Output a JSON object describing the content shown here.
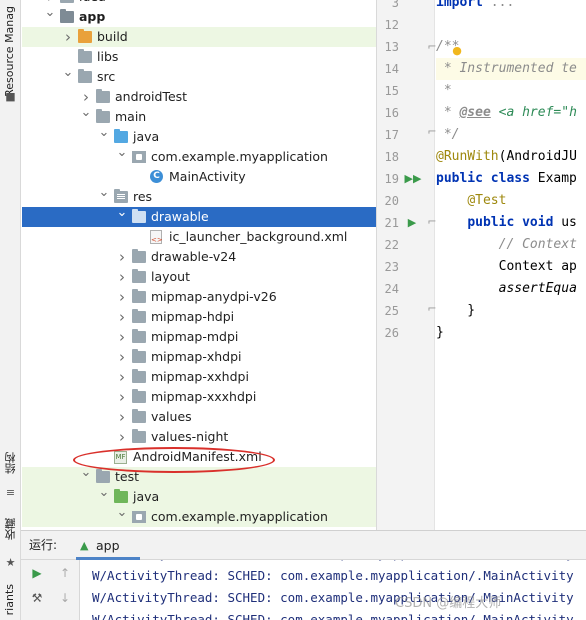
{
  "tool_strip": {
    "resource_manager": "Resource Manag",
    "structure": "结构",
    "favorites": "收藏",
    "variants": "riants"
  },
  "tree": {
    "rows": [
      {
        "label": "idea",
        "depth": 2,
        "arrow": "right",
        "icon": "folder-grey"
      },
      {
        "label": "app",
        "depth": 2,
        "arrow": "down",
        "icon": "module",
        "bold": true
      },
      {
        "label": "build",
        "depth": 3,
        "arrow": "right",
        "icon": "folder-orange",
        "green": true
      },
      {
        "label": "libs",
        "depth": 3,
        "arrow": "",
        "icon": "folder-grey"
      },
      {
        "label": "src",
        "depth": 3,
        "arrow": "down",
        "icon": "folder-grey"
      },
      {
        "label": "androidTest",
        "depth": 4,
        "arrow": "right",
        "icon": "folder-grey"
      },
      {
        "label": "main",
        "depth": 4,
        "arrow": "down",
        "icon": "folder-grey"
      },
      {
        "label": "java",
        "depth": 5,
        "arrow": "down",
        "icon": "folder-blue"
      },
      {
        "label": "com.example.myapplication",
        "depth": 6,
        "arrow": "down",
        "icon": "package"
      },
      {
        "label": "MainActivity",
        "depth": 7,
        "arrow": "",
        "icon": "class"
      },
      {
        "label": "res",
        "depth": 5,
        "arrow": "down",
        "icon": "folder-res"
      },
      {
        "label": "drawable",
        "depth": 6,
        "arrow": "down",
        "icon": "folder-white",
        "selected": true
      },
      {
        "label": "ic_launcher_background.xml",
        "depth": 7,
        "arrow": "",
        "icon": "xml"
      },
      {
        "label": "drawable-v24",
        "depth": 6,
        "arrow": "right",
        "icon": "folder-grey"
      },
      {
        "label": "layout",
        "depth": 6,
        "arrow": "right",
        "icon": "folder-grey"
      },
      {
        "label": "mipmap-anydpi-v26",
        "depth": 6,
        "arrow": "right",
        "icon": "folder-grey"
      },
      {
        "label": "mipmap-hdpi",
        "depth": 6,
        "arrow": "right",
        "icon": "folder-grey"
      },
      {
        "label": "mipmap-mdpi",
        "depth": 6,
        "arrow": "right",
        "icon": "folder-grey"
      },
      {
        "label": "mipmap-xhdpi",
        "depth": 6,
        "arrow": "right",
        "icon": "folder-grey"
      },
      {
        "label": "mipmap-xxhdpi",
        "depth": 6,
        "arrow": "right",
        "icon": "folder-grey"
      },
      {
        "label": "mipmap-xxxhdpi",
        "depth": 6,
        "arrow": "right",
        "icon": "folder-grey"
      },
      {
        "label": "values",
        "depth": 6,
        "arrow": "right",
        "icon": "folder-grey"
      },
      {
        "label": "values-night",
        "depth": 6,
        "arrow": "right",
        "icon": "folder-grey"
      },
      {
        "label": "AndroidManifest.xml",
        "depth": 5,
        "arrow": "",
        "icon": "manifest"
      },
      {
        "label": "test",
        "depth": 4,
        "arrow": "down",
        "icon": "folder-grey",
        "green": true
      },
      {
        "label": "java",
        "depth": 5,
        "arrow": "down",
        "icon": "folder-green",
        "green": true
      },
      {
        "label": "com.example.myapplication",
        "depth": 6,
        "arrow": "down",
        "icon": "package",
        "green": true
      }
    ]
  },
  "editor": {
    "line_numbers": [
      "3",
      "12",
      "13",
      "14",
      "15",
      "16",
      "17",
      "18",
      "19",
      "20",
      "21",
      "22",
      "23",
      "24",
      "25",
      "26"
    ],
    "lines": [
      [
        {
          "t": "import ",
          "c": "kw"
        },
        {
          "t": "...",
          "c": "grey"
        }
      ],
      [],
      [
        {
          "t": "/**",
          "c": "doc"
        }
      ],
      [
        {
          "t": " * Instrumented te",
          "c": "doc"
        }
      ],
      [
        {
          "t": " *",
          "c": "doc"
        }
      ],
      [
        {
          "t": " * ",
          "c": "doc"
        },
        {
          "t": "@see",
          "c": "doctag"
        },
        {
          "t": " ",
          "c": "doc"
        },
        {
          "t": "<a href=\"h",
          "c": "link"
        }
      ],
      [
        {
          "t": " */",
          "c": "doc"
        }
      ],
      [
        {
          "t": "@RunWith",
          "c": "ann"
        },
        {
          "t": "(AndroidJU",
          "c": ""
        }
      ],
      [
        {
          "t": "public class ",
          "c": "kw"
        },
        {
          "t": "Examp",
          "c": ""
        }
      ],
      [
        {
          "t": "    ",
          "c": ""
        },
        {
          "t": "@Test",
          "c": "ann"
        }
      ],
      [
        {
          "t": "    ",
          "c": ""
        },
        {
          "t": "public void ",
          "c": "kw"
        },
        {
          "t": "us",
          "c": ""
        }
      ],
      [
        {
          "t": "        ",
          "c": ""
        },
        {
          "t": "// Context",
          "c": "grey-i"
        }
      ],
      [
        {
          "t": "        Context ap",
          "c": ""
        }
      ],
      [
        {
          "t": "        ",
          "c": ""
        },
        {
          "t": "assertEqua",
          "c": "plain-i"
        }
      ],
      [
        {
          "t": "    }",
          "c": ""
        }
      ],
      [
        {
          "t": "}",
          "c": ""
        }
      ]
    ]
  },
  "run_panel": {
    "label": "运行:",
    "tab": "app",
    "lines": [
      "W/ActivityThread: SCHED: com.example.myapplication/.MainActivity",
      "W/ActivityThread: SCHED: com.example.myapplication/.MainActivity",
      "W/ActivityThread: SCHED: com.example.myapplication/.MainActivity",
      "W/ActivityThread: SCHED: com.example.myapplication/.MainActivity"
    ]
  },
  "watermark": "CSDN @编程大师",
  "colors": {
    "selection": "#2a6bc4",
    "excluded_green": "#edf7e3",
    "annotation_circle": "#d9302b",
    "keyword": "#0033b3"
  }
}
